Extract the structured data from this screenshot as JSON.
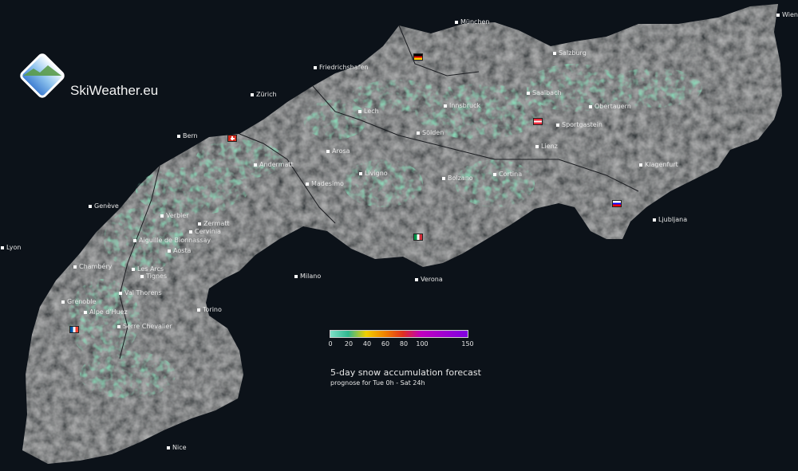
{
  "brand": {
    "name": "SkiWeather.eu"
  },
  "legend": {
    "ticks": [
      "0",
      "20",
      "40",
      "60",
      "80",
      "100",
      "150"
    ],
    "title": "5-day snow accumulation forecast",
    "subtitle": "prognose for Tue 0h - Sat 24h"
  },
  "cities": [
    {
      "name": "München"
    },
    {
      "name": "Wien"
    },
    {
      "name": "Salzburg"
    },
    {
      "name": "Friedrichshafen"
    },
    {
      "name": "Zürich"
    },
    {
      "name": "Saalbach"
    },
    {
      "name": "Innsbruck"
    },
    {
      "name": "Obertauern"
    },
    {
      "name": "Lech"
    },
    {
      "name": "Sportgastein"
    },
    {
      "name": "Bern"
    },
    {
      "name": "Sölden"
    },
    {
      "name": "Lienz"
    },
    {
      "name": "Arosa"
    },
    {
      "name": "Klagenfurt"
    },
    {
      "name": "Andermatt"
    },
    {
      "name": "Livigno"
    },
    {
      "name": "Cortina"
    },
    {
      "name": "Bolzano"
    },
    {
      "name": "Madesimo"
    },
    {
      "name": "Genève"
    },
    {
      "name": "Verbier"
    },
    {
      "name": "Zermatt"
    },
    {
      "name": "Ljubljana"
    },
    {
      "name": "Cervinia"
    },
    {
      "name": "Aiguille de Bionnassay"
    },
    {
      "name": "Lyon"
    },
    {
      "name": "Aosta"
    },
    {
      "name": "Chambéry"
    },
    {
      "name": "Les Arcs"
    },
    {
      "name": "Tignes"
    },
    {
      "name": "Milano"
    },
    {
      "name": "Verona"
    },
    {
      "name": "Val Thorens"
    },
    {
      "name": "Grenoble"
    },
    {
      "name": "Torino"
    },
    {
      "name": "Alpe d'Huez"
    },
    {
      "name": "Serre Chevalier"
    },
    {
      "name": "Nice"
    }
  ],
  "flags": [
    "germany-flag",
    "switzerland-flag",
    "austria-flag",
    "slovenia-flag",
    "italy-flag",
    "france-flag"
  ],
  "colors": {
    "background": "#0c1219",
    "terrain": "#3a3d42",
    "snow": "#3fae7c"
  }
}
